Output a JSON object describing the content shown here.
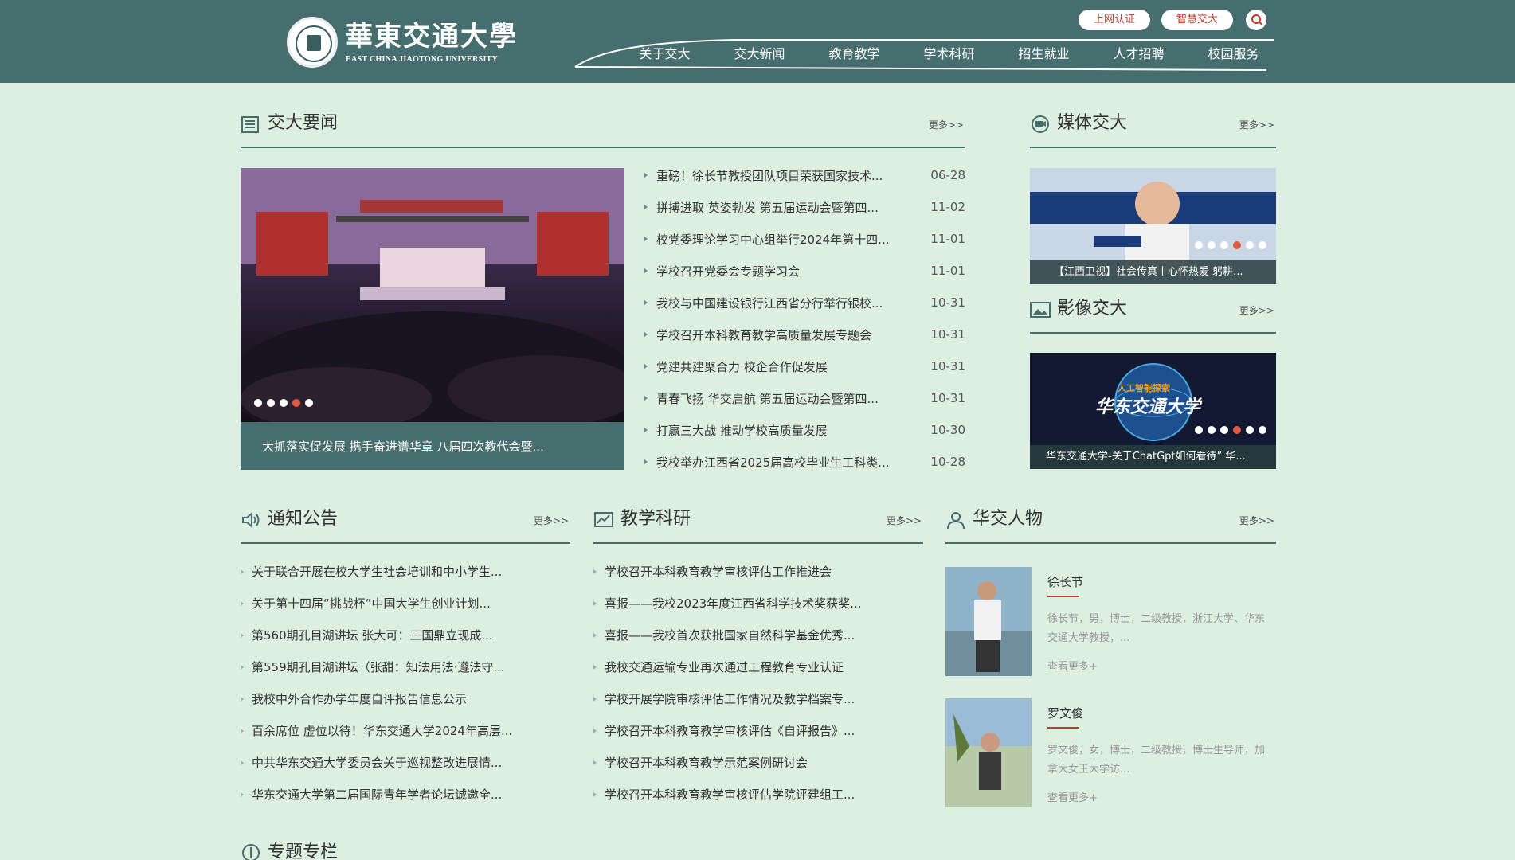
{
  "header": {
    "logo_cn": "華東交通大學",
    "logo_en": "EAST CHINA JIAOTONG UNIVERSITY",
    "pills": [
      "上网认证",
      "智慧交大"
    ],
    "nav": [
      "关于交大",
      "交大新闻",
      "教育教学",
      "学术科研",
      "招生就业",
      "人才招聘",
      "校园服务"
    ]
  },
  "more_label": "更多>>",
  "news": {
    "title": "交大要闻",
    "slide_caption": "大抓落实促发展 携手奋进谱华章 八届四次教代会暨...",
    "items": [
      {
        "title": "重磅！徐长节教授团队项目荣获国家技术...",
        "date": "06-28"
      },
      {
        "title": "拼搏进取 英姿勃发 第五届运动会暨第四...",
        "date": "11-02"
      },
      {
        "title": "校党委理论学习中心组举行2024年第十四...",
        "date": "11-01"
      },
      {
        "title": "学校召开党委会专题学习会",
        "date": "11-01"
      },
      {
        "title": "我校与中国建设银行江西省分行举行银校...",
        "date": "10-31"
      },
      {
        "title": "学校召开本科教育教学高质量发展专题会",
        "date": "10-31"
      },
      {
        "title": "党建共建聚合力 校企合作促发展",
        "date": "10-31"
      },
      {
        "title": "青春飞扬 华交启航 第五届运动会暨第四...",
        "date": "10-31"
      },
      {
        "title": "打赢三大战 推动学校高质量发展",
        "date": "10-30"
      },
      {
        "title": "我校举办江西省2025届高校毕业生工科类...",
        "date": "10-28"
      }
    ]
  },
  "media": {
    "title": "媒体交大",
    "caption": "【江西卫视】社会传真丨心怀热爱 躬耕..."
  },
  "video": {
    "title": "影像交大",
    "caption": "华东交通大学-关于ChatGpt如何看待” 华...",
    "overlay": "华东交通大学",
    "overlay_small": "人工智能探索"
  },
  "notices": {
    "title": "通知公告",
    "items": [
      "关于联合开展在校大学生社会培训和中小学生...",
      "关于第十四届“挑战杯”中国大学生创业计划...",
      "第560期孔目湖讲坛 张大可：三国鼎立现成...",
      "第559期孔目湖讲坛（张甜：知法用法·遵法守...",
      "我校中外合作办学年度自评报告信息公示",
      "百余席位 虚位以待！华东交通大学2024年高层...",
      "中共华东交通大学委员会关于巡视整改进展情...",
      "华东交通大学第二届国际青年学者论坛诚邀全..."
    ]
  },
  "research": {
    "title": "教学科研",
    "items": [
      "学校召开本科教育教学审核评估工作推进会",
      "喜报——我校2023年度江西省科学技术奖获奖...",
      "喜报——我校首次获批国家自然科学基金优秀...",
      "我校交通运输专业再次通过工程教育专业认证",
      "学校开展学院审核评估工作情况及教学档案专...",
      "学校召开本科教育教学审核评估《自评报告》...",
      "学校召开本科教育教学示范案例研讨会",
      "学校召开本科教育教学审核评估学院评建组工..."
    ]
  },
  "people": {
    "title": "华交人物",
    "items": [
      {
        "name": "徐长节",
        "desc": "徐长节，男，博士，二级教授，浙江大学、华东交通大学教授，...",
        "more": "查看更多+"
      },
      {
        "name": "罗文俊",
        "desc": "罗文俊，女，博士，二级教授，博士生导师，加拿大女王大学访...",
        "more": "查看更多+"
      }
    ]
  },
  "special": {
    "title": "专题专栏"
  },
  "colors": {
    "header": "#466e6e",
    "background": "#dcefe0",
    "accent": "#c0392b"
  }
}
